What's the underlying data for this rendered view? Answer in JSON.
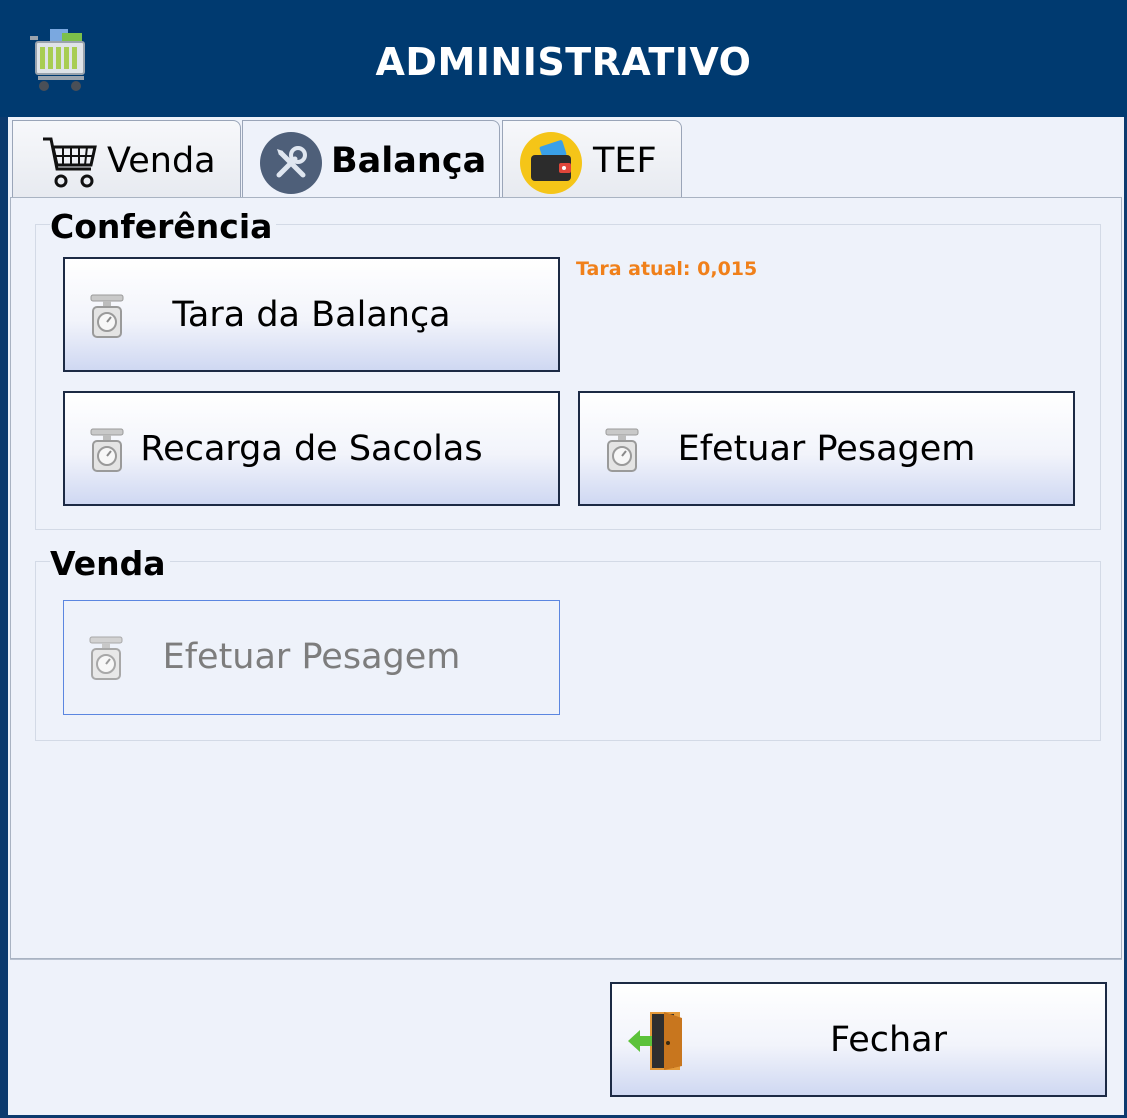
{
  "window": {
    "title": "ADMINISTRATIVO"
  },
  "tabs": [
    {
      "label": "Venda",
      "icon": "shopping-cart-icon",
      "active": false
    },
    {
      "label": "Balança",
      "icon": "tools-icon",
      "active": true
    },
    {
      "label": "TEF",
      "icon": "card-wallet-icon",
      "active": false
    }
  ],
  "groups": {
    "conferencia": {
      "title": "Conferência",
      "tara_label": "Tara atual:",
      "tara_value": "0,015",
      "buttons": {
        "tara": "Tara da Balança",
        "recarga": "Recarga de Sacolas",
        "pesagem": "Efetuar Pesagem"
      }
    },
    "venda": {
      "title": "Venda",
      "buttons": {
        "pesagem": "Efetuar Pesagem"
      }
    }
  },
  "footer": {
    "close_label": "Fechar"
  },
  "colors": {
    "titlebar": "#003a70",
    "accent_orange": "#f0801a",
    "disabled_border": "#5b86e0"
  }
}
